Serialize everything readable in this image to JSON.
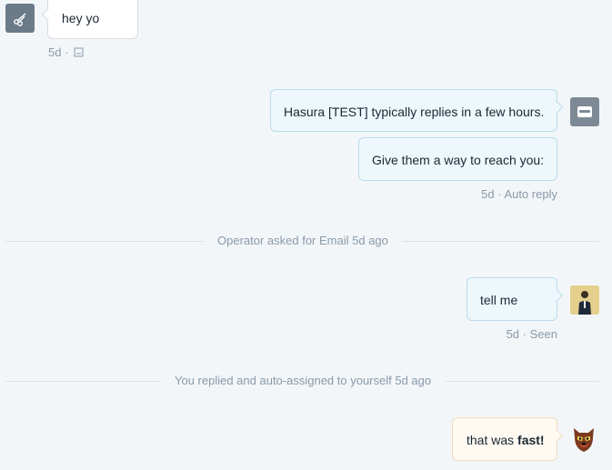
{
  "messages": {
    "user_msg": {
      "text": "hey yo",
      "time": "5d",
      "separator": "·",
      "icon": "seen-box-icon"
    },
    "op_auto_1": {
      "text": "Hasura [TEST] typically replies in a few hours."
    },
    "op_auto_2": {
      "text": "Give them a way to reach you:",
      "time": "5d",
      "separator": "·",
      "status": "Auto reply"
    },
    "op_reply": {
      "text": "tell me",
      "time": "5d",
      "separator": "·",
      "status": "Seen"
    },
    "op_fast": {
      "text_before": "that was ",
      "text_bold": "fast!"
    }
  },
  "dividers": {
    "email_request": "Operator asked for Email 5d ago",
    "assigned": "You replied and auto-assigned to yourself 5d ago"
  },
  "avatars": {
    "user": "scissors-icon",
    "bot": "bot-icon",
    "operator_photo": "operator-photo",
    "operator_fox": "fox-mascot-icon"
  },
  "colors": {
    "background": "#f3f6f8",
    "operator_bubble": "#eef7fc",
    "user_bubble": "#ffffff",
    "highlight_bubble": "#fef9f1",
    "avatar_gray": "#6b7a88"
  }
}
